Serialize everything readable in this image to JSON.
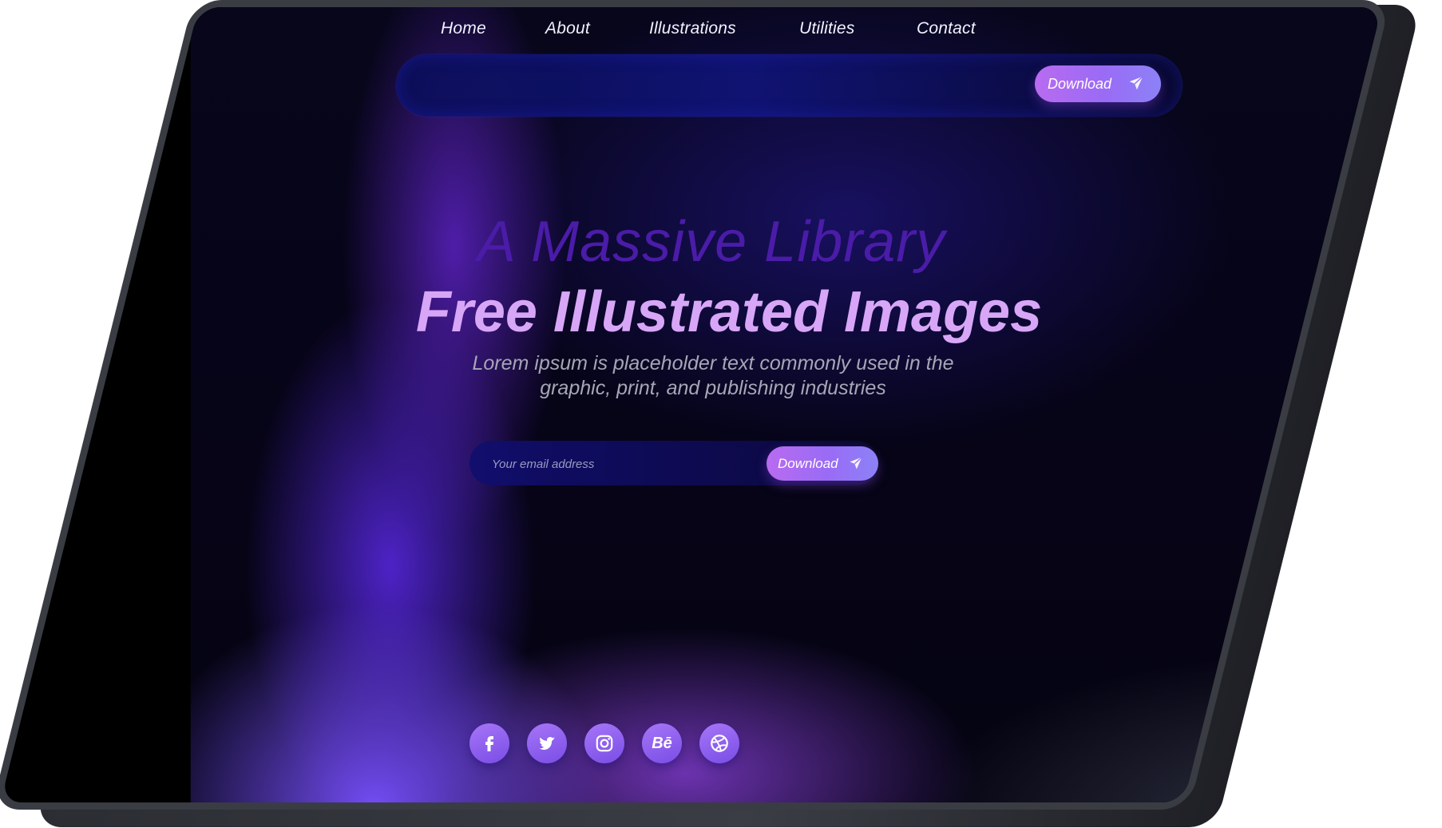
{
  "nav": {
    "items": [
      {
        "label": "Home"
      },
      {
        "label": "About"
      },
      {
        "label": "Illustrations"
      },
      {
        "label": "Utilities"
      },
      {
        "label": "Contact"
      }
    ],
    "cta_label": "Download"
  },
  "hero": {
    "kicker": "A Massive Library",
    "title": "Free Illustrated Images",
    "subtitle_line1": "Lorem ipsum is placeholder text commonly used in the",
    "subtitle_line2": "graphic, print, and publishing industries",
    "email_placeholder": "Your email address",
    "cta_label": "Download"
  },
  "socials": [
    {
      "icon": "facebook-icon"
    },
    {
      "icon": "twitter-icon"
    },
    {
      "icon": "instagram-icon"
    },
    {
      "icon": "behance-icon",
      "text": "Bē"
    },
    {
      "icon": "dribbble-icon"
    }
  ],
  "colors": {
    "accent_start": "#b86bf0",
    "accent_end": "#8c82f7",
    "title": "#d8a6f7",
    "kicker": "#4a1ca8",
    "social": "#8a5ef0"
  }
}
